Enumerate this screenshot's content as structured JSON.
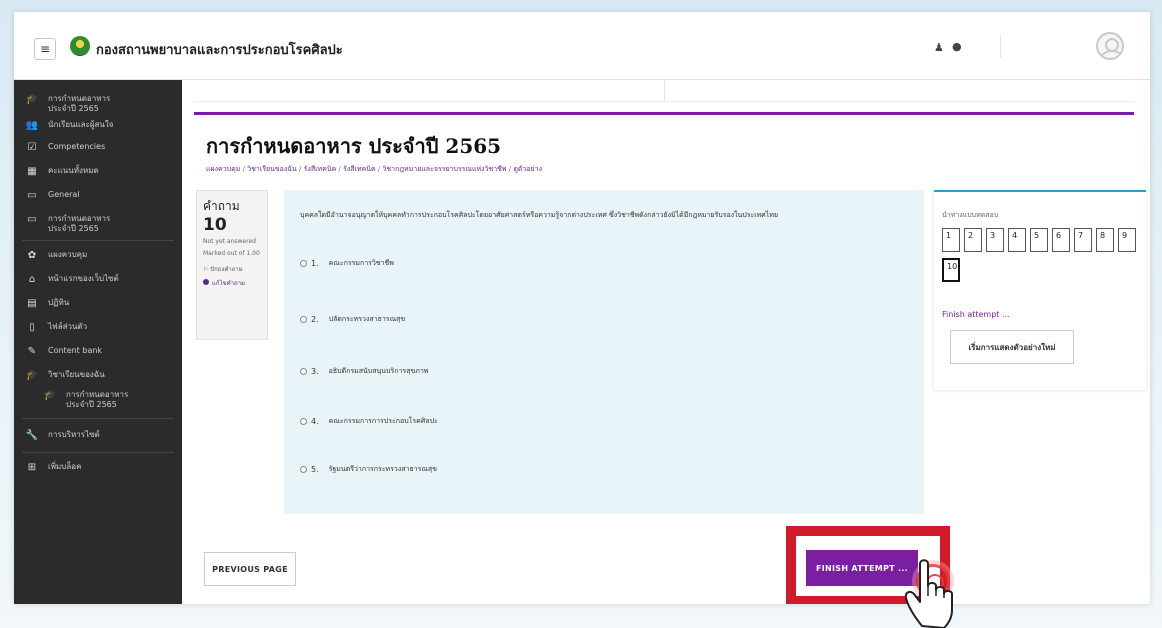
{
  "navbar": {
    "menu_icon": "hamburger-icon",
    "site_name": "กองสถานพยาบาลและการประกอบโรคศิลปะ",
    "bell_icon": "bell-icon",
    "chat_icon": "chat-icon",
    "avatar_icon": "user-avatar-icon"
  },
  "sidebar": {
    "items": [
      {
        "icon": "graduation-cap-icon",
        "label": "การกำหนดอาหาร ประจำปี 2565"
      },
      {
        "icon": "users-icon",
        "label": "นักเรียนและผู้สนใจ"
      },
      {
        "icon": "checkbox-icon",
        "label": "Competencies"
      },
      {
        "icon": "grades-icon",
        "label": "คะแนนทั้งหมด"
      },
      {
        "icon": "folder-icon",
        "label": "General"
      },
      {
        "icon": "folder-icon",
        "label": "การกำหนดอาหาร ประจำปี 2565"
      },
      {
        "icon": "dashboard-icon",
        "label": "แผงควบคุม"
      },
      {
        "icon": "home-icon",
        "label": "หน้าแรกของเว็บไซต์"
      },
      {
        "icon": "calendar-icon",
        "label": "ปฏิทิน"
      },
      {
        "icon": "file-icon",
        "label": "ไฟล์ส่วนตัว"
      },
      {
        "icon": "pencil-icon",
        "label": "Content bank"
      },
      {
        "icon": "graduation-cap-icon",
        "label": "วิชาเรียนของฉัน"
      },
      {
        "icon": "graduation-cap-icon",
        "label": "การกำหนดอาหาร ประจำปี 2565"
      },
      {
        "icon": "wrench-icon",
        "label": "การบริหารไซต์"
      },
      {
        "icon": "plus-square-icon",
        "label": "เพิ่มบล็อค"
      }
    ]
  },
  "page": {
    "title": "การกำหนดอาหาร ประจำปี 2565",
    "breadcrumb": [
      "แผงควบคุม",
      "วิชาเรียนของฉัน",
      "รังสีเทคนิค",
      "รังสีเทคนิค",
      "วิชากฎหมายและจรรยาบรรณแห่งวิชาชีพ",
      "ดูตัวอย่าง"
    ],
    "breadcrumb_sep": " / "
  },
  "question": {
    "label": "คำถาม",
    "number": "10",
    "status": "Not yet answered",
    "marked_out_of": "Marked out of 1.00",
    "flag": "ปักธงคำถาม",
    "edit": "แก้ไขคำถาม",
    "text": "บุคคลใดมีอำนาจอนุญาตให้บุคคลทำการประกอบโรคศิลปะโดยอาศัยศาสตร์หรือความรู้จากต่างประเทศ ซึ่งวิชาชีพดังกล่าวยังมิได้มีกฎหมายรับรองในประเทศไทย",
    "choices": [
      {
        "num": "1.",
        "text": "คณะกรรมการวิชาชีพ"
      },
      {
        "num": "2.",
        "text": "ปลัดกระทรวงสาธารณสุข"
      },
      {
        "num": "3.",
        "text": "อธิบดีกรมสนับสนุนบริการสุขภาพ"
      },
      {
        "num": "4.",
        "text": "คณะกรรมการการประกอบโรคศิลปะ"
      },
      {
        "num": "5.",
        "text": "รัฐมนตรีว่าการกระทรวงสาธารณสุข"
      }
    ]
  },
  "quiz_nav": {
    "title": "นำทางแบบทดสอบ",
    "buttons": [
      "1",
      "2",
      "3",
      "4",
      "5",
      "6",
      "7",
      "8",
      "9",
      "10"
    ],
    "current": "10",
    "finish_link": "Finish attempt ...",
    "new_preview": "เริ่มการแสดงตัวอย่างใหม่"
  },
  "footer_buttons": {
    "previous": "PREVIOUS PAGE",
    "finish": "FINISH ATTEMPT ..."
  },
  "colors": {
    "accent": "#7a1fa2",
    "highlight": "#d0192b",
    "sidebar_bg": "#2b2b2b",
    "question_bg": "#e8f4f7"
  }
}
